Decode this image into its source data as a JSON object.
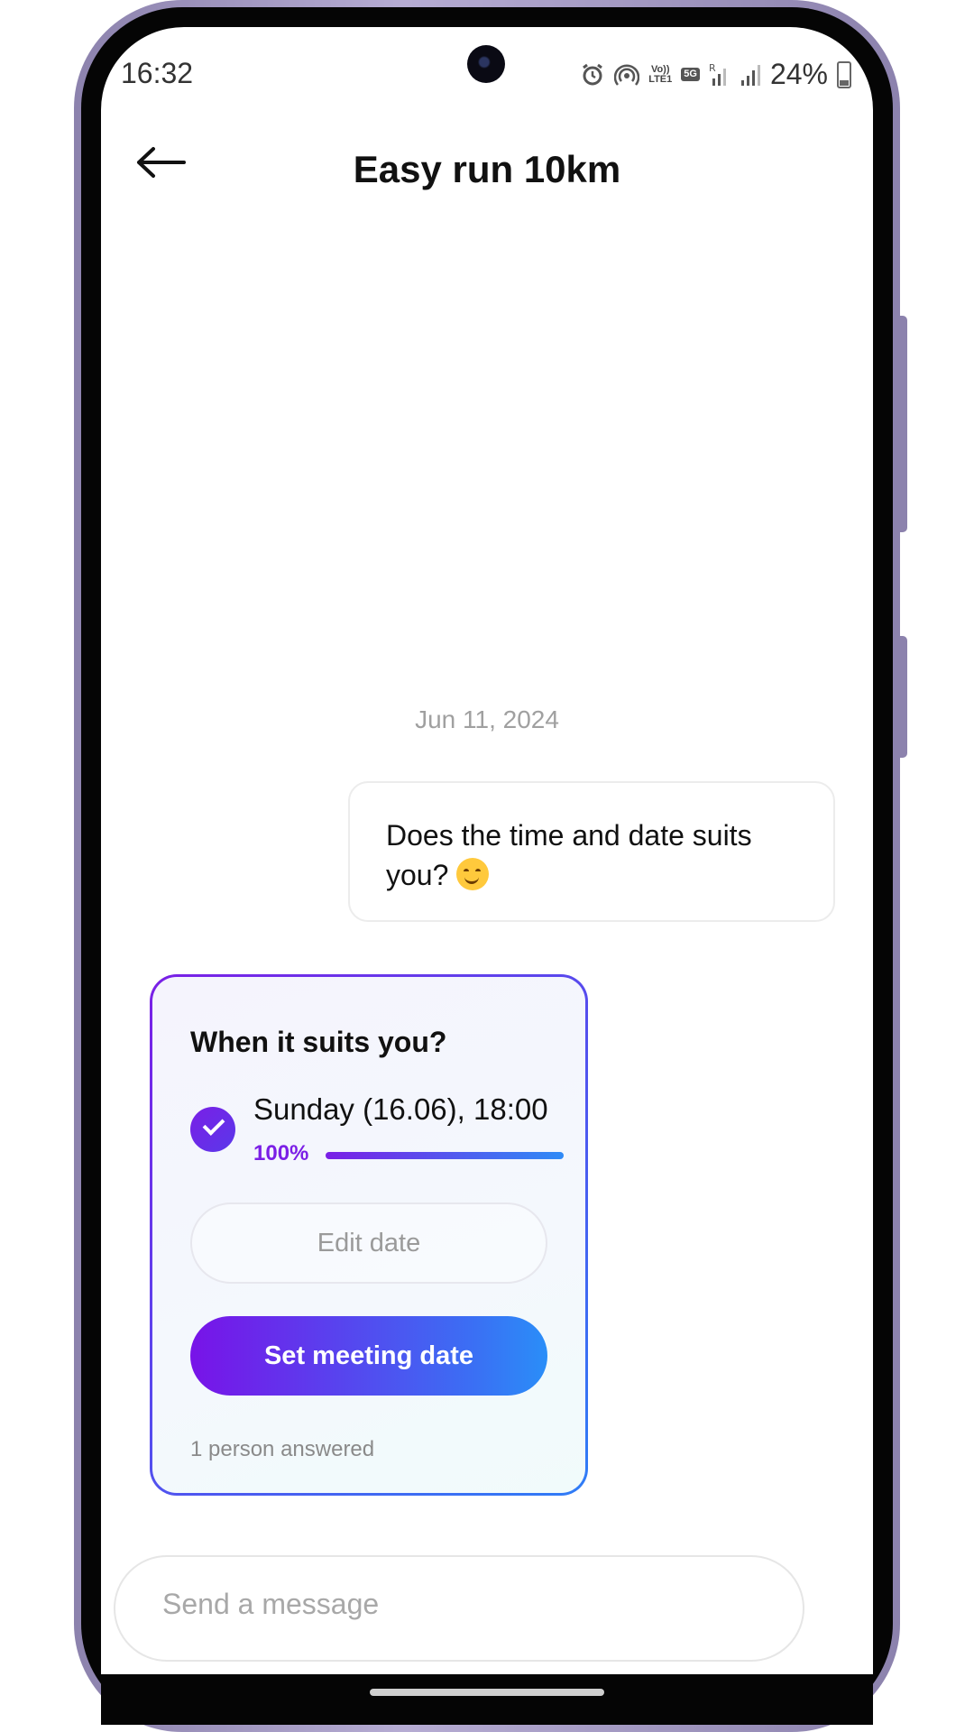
{
  "status_bar": {
    "time": "16:32",
    "battery": "24%",
    "icons": [
      "alarm-icon",
      "hotspot-icon",
      "volte-icon",
      "5g-icon",
      "signal-roaming-icon",
      "signal-icon",
      "battery-icon"
    ],
    "tags": {
      "volte": "Vo))\nLTE1",
      "fiveg": "5G",
      "roaming": "R"
    }
  },
  "header": {
    "title": "Easy run 10km",
    "back_icon": "arrow-left-icon"
  },
  "chat": {
    "date_separator": "Jun 11, 2024",
    "message": {
      "text": "Does the time and date suits you? ",
      "emoji": "smiling-face-icon"
    },
    "poll": {
      "question": "When it suits you?",
      "option": {
        "label": "Sunday (16.06), 18:00",
        "percent_label": "100%",
        "fraction": 1.0,
        "selected": true
      },
      "edit_button": "Edit date",
      "set_button": "Set meeting date",
      "answered_count": "1 person answered"
    }
  },
  "composer": {
    "placeholder": "Send a message"
  },
  "colors": {
    "accent_purple": "#7a1fe6",
    "accent_blue": "#2f7df6",
    "frame": "#8c82ad"
  }
}
